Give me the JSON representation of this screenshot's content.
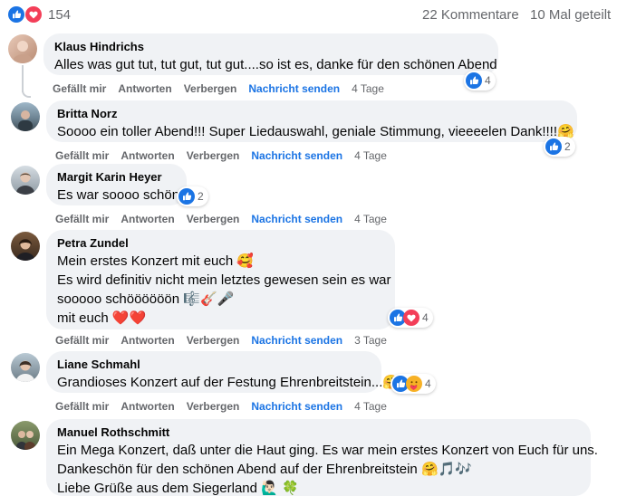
{
  "summary": {
    "reaction_count": "154",
    "comments": "22 Kommentare",
    "shares": "10 Mal geteilt",
    "reaction_icons": [
      "like-icon",
      "love-icon"
    ]
  },
  "actions": {
    "like": "Gefällt mir",
    "reply": "Antworten",
    "hide": "Verbergen",
    "message": "Nachricht senden"
  },
  "comments": [
    {
      "author": "Klaus Hindrichs",
      "lines": [
        "Alles was gut tut, tut gut, tut gut....so ist es, danke für den schönen Abend"
      ],
      "reactions": "4",
      "age": "4 Tage"
    },
    {
      "author": "Britta Norz",
      "lines": [
        "Soooo ein toller Abend!!! Super Liedauswahl, geniale Stimmung, vieeeelen Dank!!!!🤗"
      ],
      "reactions": "2",
      "age": "4 Tage"
    },
    {
      "author": "Margit Karin Heyer",
      "lines": [
        "Es war soooo schön"
      ],
      "reactions": "2",
      "age": "4 Tage"
    },
    {
      "author": "Petra Zundel",
      "lines": [
        "Mein erstes Konzert mit euch 🥰",
        "Es wird definitiv nicht mein letztes gewesen sein es war",
        "sooooo schöööööön 🎼🎸🎤",
        "mit euch ❤️❤️"
      ],
      "reactions": "4",
      "age": "3 Tage"
    },
    {
      "author": "Liane Schmahl",
      "lines": [
        "Grandioses Konzert auf der Festung Ehrenbreitstein...🤗"
      ],
      "reactions": "4",
      "age": "4 Tage"
    },
    {
      "author": "Manuel Rothschmitt",
      "lines": [
        "Ein Mega Konzert, daß unter die Haut ging. Es war mein erstes Konzert von Euch für uns.",
        "Dankeschön für den schönen Abend auf der Ehrenbreitstein 🤗🎵🎶",
        "Liebe Grüße aus dem Siegerland 🙋🏻‍♂️ 🍀"
      ]
    }
  ],
  "colors": {
    "bubble": "#f0f2f5",
    "like_blue": "#1b74e4",
    "love_red": "#f33e58",
    "muted": "#65676b"
  }
}
